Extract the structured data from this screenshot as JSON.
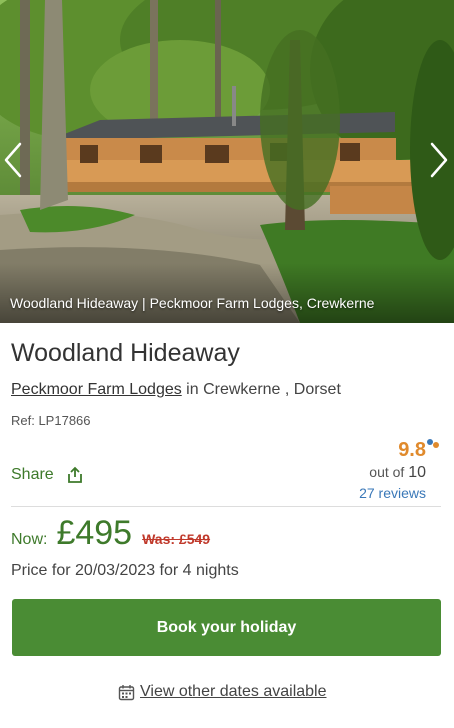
{
  "hero": {
    "caption": "Woodland Hideaway | Peckmoor Farm Lodges, Crewkerne",
    "prev_icon": "chevron-left-icon",
    "next_icon": "chevron-right-icon"
  },
  "property": {
    "title": "Woodland Hideaway",
    "park_link": "Peckmoor Farm Lodges",
    "location_text": " in Crewkerne , Dorset",
    "ref": "Ref: LP17866"
  },
  "share": {
    "label": "Share",
    "icon": "share-icon"
  },
  "rating": {
    "score": "9.8",
    "out_of_prefix": "out of ",
    "out_of_value": "10",
    "reviews": "27 reviews"
  },
  "pricing": {
    "now_label": "Now:",
    "now_price": "£495",
    "was_price": "Was: £549",
    "note": "Price for 20/03/2023 for 4 nights"
  },
  "actions": {
    "book_label": "Book your holiday",
    "other_dates_label": "View other dates available",
    "other_dates_icon": "calendar-icon"
  },
  "colors": {
    "brand_green": "#4a8c34",
    "text_green": "#3e7a2b",
    "score_orange": "#e08a2c",
    "link_blue": "#3a78b8",
    "was_red": "#c0392b"
  }
}
